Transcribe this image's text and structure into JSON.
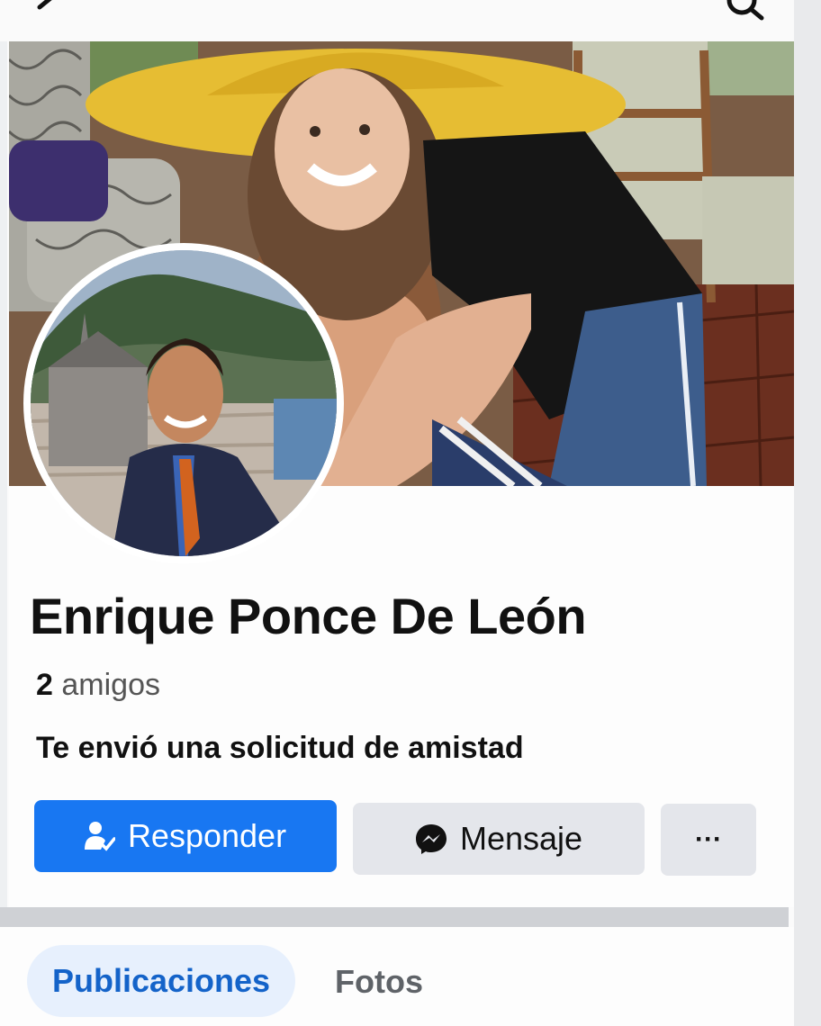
{
  "profile": {
    "name": "Enrique Ponce De León",
    "friends_count": "2",
    "friends_label": "amigos",
    "request_text": "Te envió una solicitud de amistad"
  },
  "actions": {
    "respond_label": "Responder",
    "message_label": "Mensaje",
    "more_label": "···"
  },
  "tabs": [
    {
      "label": "Publicaciones",
      "active": true
    },
    {
      "label": "Fotos",
      "active": false
    }
  ],
  "icons": {
    "back": "back-arrow-icon",
    "search": "search-icon",
    "respond": "person-check-icon",
    "message": "messenger-icon"
  },
  "colors": {
    "primary": "#1877f2",
    "secondary_button": "#e4e6eb",
    "active_tab_bg": "#e7f0fd",
    "active_tab_text": "#1463c9"
  }
}
